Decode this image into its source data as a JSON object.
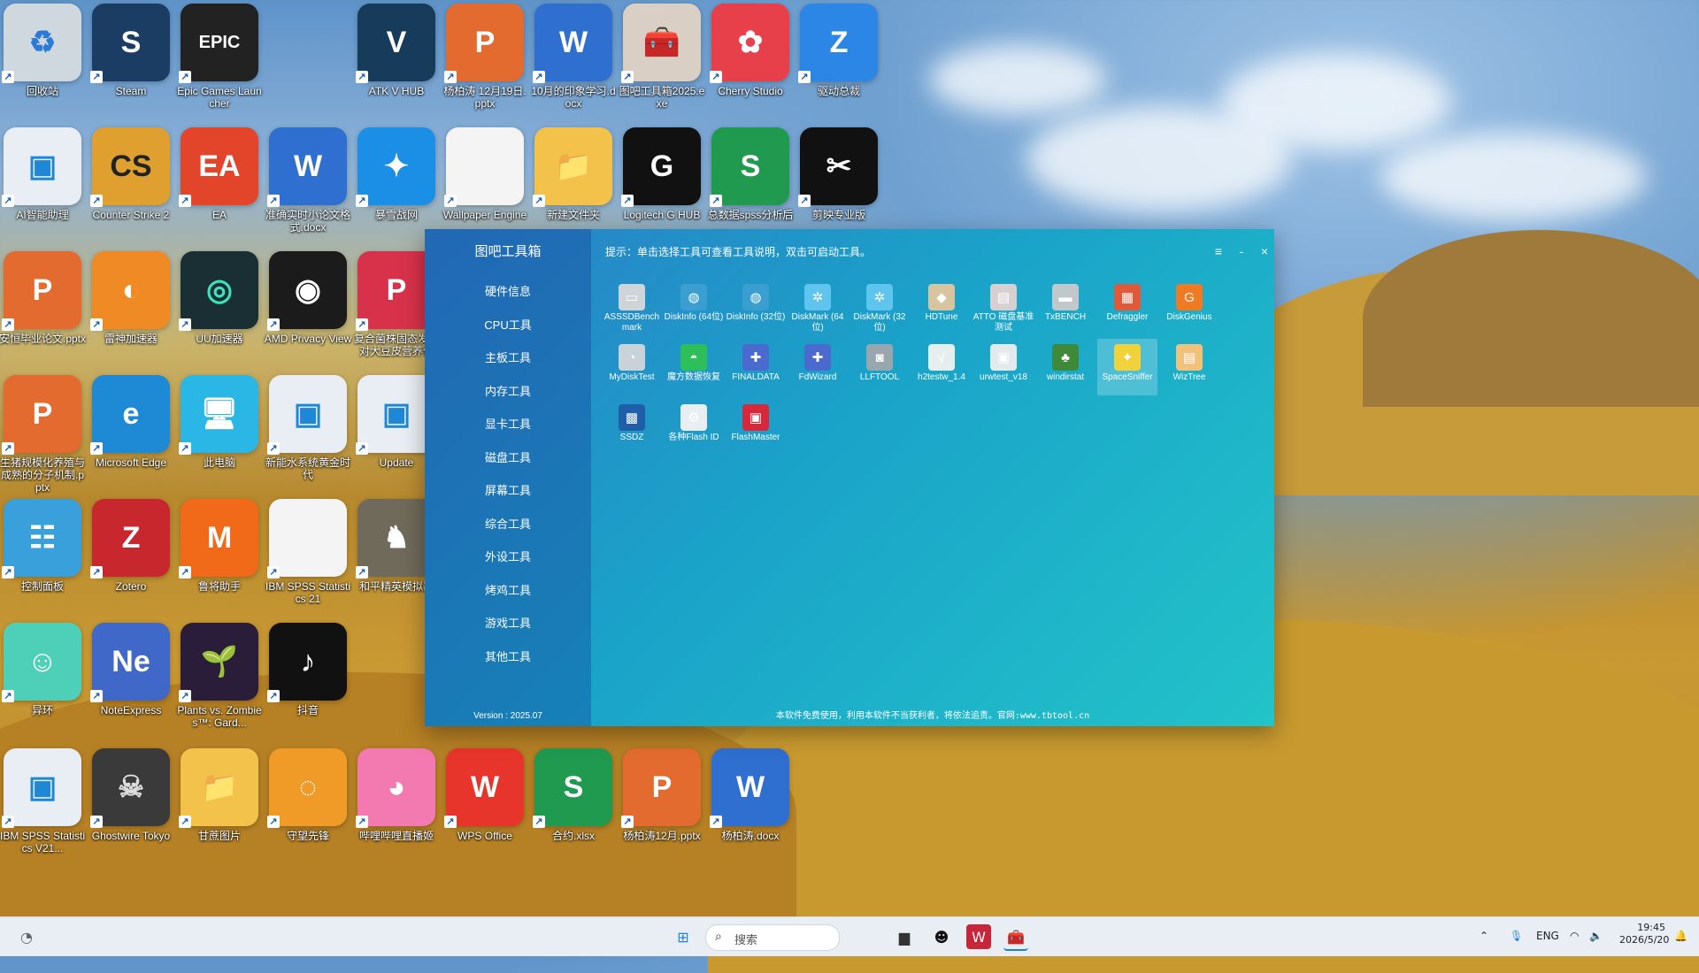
{
  "desktop": {
    "icons": [
      {
        "label": "回收站",
        "glyph": "♻",
        "color": "#cfd8df",
        "fg": "#2a7ad6"
      },
      {
        "label": "Steam",
        "glyph": "S",
        "color": "#1b3d63",
        "fg": "#fff"
      },
      {
        "label": "Epic Games Launcher",
        "glyph": "EPIC",
        "color": "#222",
        "fg": "#fff"
      },
      {
        "label": "ATK V HUB",
        "glyph": "V",
        "color": "#173b5a",
        "fg": "#fff"
      },
      {
        "label": "杨柏涛 12月19日.pptx",
        "glyph": "P",
        "color": "#e36b2f",
        "fg": "#fff"
      },
      {
        "label": "10月的印象学习.docx",
        "glyph": "W",
        "color": "#2f6fd0",
        "fg": "#fff"
      },
      {
        "label": "图吧工具箱2025.exe",
        "glyph": "🧰",
        "color": "#d9cfc4",
        "fg": "#333"
      },
      {
        "label": "Cherry Studio",
        "glyph": "✿",
        "color": "#e8404b",
        "fg": "#fff"
      },
      {
        "label": "驱动总裁",
        "glyph": "Z",
        "color": "#2b86e6",
        "fg": "#fff"
      },
      {
        "label": "AI智能助理",
        "glyph": "▣",
        "color": "#e8eef4",
        "fg": "#1e88d6"
      },
      {
        "label": "Counter Strike 2",
        "glyph": "CS",
        "color": "#e0a030",
        "fg": "#222"
      },
      {
        "label": "EA",
        "glyph": "EA",
        "color": "#e2452a",
        "fg": "#fff"
      },
      {
        "label": "准确实时小论文格式.docx",
        "glyph": "W",
        "color": "#2f6fd0",
        "fg": "#fff"
      },
      {
        "label": "暴雪战网",
        "glyph": "✦",
        "color": "#1b8fe6",
        "fg": "#fff"
      },
      {
        "label": "Wallpaper Engine",
        "glyph": "",
        "color": "#f4f4f4",
        "fg": "#333"
      },
      {
        "label": "新建文件夹",
        "glyph": "📁",
        "color": "#f2c24b",
        "fg": "#333"
      },
      {
        "label": "Logitech G HUB",
        "glyph": "G",
        "color": "#111",
        "fg": "#fff"
      },
      {
        "label": "总数据spss分析后",
        "glyph": "S",
        "color": "#1f9a4f",
        "fg": "#fff"
      },
      {
        "label": "剪映专业版",
        "glyph": "✂",
        "color": "#111",
        "fg": "#fff"
      },
      {
        "label": "安恒毕业论文.pptx",
        "glyph": "P",
        "color": "#e36b2f",
        "fg": "#fff"
      },
      {
        "label": "雷神加速器",
        "glyph": "◐",
        "color": "#f08a24",
        "fg": "#fff"
      },
      {
        "label": "UU加速器",
        "glyph": "◎",
        "color": "#1a2f33",
        "fg": "#3fe0c0"
      },
      {
        "label": "AMD Privacy View",
        "glyph": "◉",
        "color": "#1b1b1b",
        "fg": "#fff"
      },
      {
        "label": "复合菌株固态发酵对大豆皮营养价",
        "glyph": "P",
        "color": "#d8324a",
        "fg": "#fff"
      },
      {
        "label": "生猪规模化养殖与成熟的分子机制.pptx",
        "glyph": "P",
        "color": "#e36b2f",
        "fg": "#fff"
      },
      {
        "label": "Microsoft Edge",
        "glyph": "e",
        "color": "#1e8ad6",
        "fg": "#fff"
      },
      {
        "label": "此电脑",
        "glyph": "🖥",
        "color": "#2bb7e6",
        "fg": "#fff"
      },
      {
        "label": "新能水系统黄金时代",
        "glyph": "▣",
        "color": "#e8eef4",
        "fg": "#1e88d6"
      },
      {
        "label": "Update",
        "glyph": "▣",
        "color": "#e8eef4",
        "fg": "#1e88d6"
      },
      {
        "label": "控制面板",
        "glyph": "☷",
        "color": "#3aa0dc",
        "fg": "#fff"
      },
      {
        "label": "Zotero",
        "glyph": "Z",
        "color": "#c8272d",
        "fg": "#fff"
      },
      {
        "label": "鲁将助手",
        "glyph": "M",
        "color": "#f06a1a",
        "fg": "#fff"
      },
      {
        "label": "IBM SPSS Statistics 21",
        "glyph": "",
        "color": "#f4f4f4",
        "fg": "#333"
      },
      {
        "label": "和平精英模拟器",
        "glyph": "♞",
        "color": "#6f6a5a",
        "fg": "#fff"
      },
      {
        "label": "异环",
        "glyph": "☺",
        "color": "#4ecfb8",
        "fg": "#fff"
      },
      {
        "label": "NoteExpress",
        "glyph": "Ne",
        "color": "#3f68c8",
        "fg": "#fff"
      },
      {
        "label": "Plants vs. Zombies™: Gard...",
        "glyph": "🌱",
        "color": "#2a1d3a",
        "fg": "#fff"
      },
      {
        "label": "抖音",
        "glyph": "♪",
        "color": "#111",
        "fg": "#fff"
      },
      {
        "label": "IBM SPSS Statistics V21...",
        "glyph": "▣",
        "color": "#e8eef4",
        "fg": "#1e88d6"
      },
      {
        "label": "Ghostwire Tokyo",
        "glyph": "☠",
        "color": "#3a3a3a",
        "fg": "#ddd"
      },
      {
        "label": "甘蔗图片",
        "glyph": "📁",
        "color": "#f2c24b",
        "fg": "#333"
      },
      {
        "label": "守望先锋",
        "glyph": "◌",
        "color": "#f09a28",
        "fg": "#fff"
      },
      {
        "label": "哔哩哔哩直播姬",
        "glyph": "◕",
        "color": "#f37ab0",
        "fg": "#fff"
      },
      {
        "label": "WPS Office",
        "glyph": "W",
        "color": "#e8352b",
        "fg": "#fff"
      },
      {
        "label": "合约.xlsx",
        "glyph": "S",
        "color": "#1f9a4f",
        "fg": "#fff"
      },
      {
        "label": "杨柏涛12月.pptx",
        "glyph": "P",
        "color": "#e36b2f",
        "fg": "#fff"
      },
      {
        "label": "杨柏涛.docx",
        "glyph": "W",
        "color": "#2f6fd0",
        "fg": "#fff"
      }
    ]
  },
  "app": {
    "title": "图吧工具箱",
    "tip": "提示：单击选择工具可查看工具说明，双击可启动工具。",
    "window_buttons": {
      "menu": "≡",
      "minimize": "-",
      "close": "×"
    },
    "categories": [
      "硬件信息",
      "CPU工具",
      "主板工具",
      "内存工具",
      "显卡工具",
      "磁盘工具",
      "屏幕工具",
      "综合工具",
      "外设工具",
      "烤鸡工具",
      "游戏工具",
      "其他工具"
    ],
    "version": "Version : 2025.07",
    "footer": "本软件免费使用，利用本软件不当获利者，将依法追责。官网:www.tbtool.cn",
    "tools": [
      {
        "label": "ASSSDBench mark",
        "glyph": "▭",
        "bg": "#cfd4d8"
      },
      {
        "label": "DiskInfo (64位)",
        "glyph": "◍",
        "bg": "#3a9fd0"
      },
      {
        "label": "DiskInfo (32位)",
        "glyph": "◍",
        "bg": "#3a9fd0"
      },
      {
        "label": "DiskMark (64位)",
        "glyph": "✲",
        "bg": "#5fc4ee"
      },
      {
        "label": "DiskMark (32位)",
        "glyph": "✲",
        "bg": "#5fc4ee"
      },
      {
        "label": "HDTune",
        "glyph": "◆",
        "bg": "#d9c4a0"
      },
      {
        "label": "ATTO 磁盘基准测试",
        "glyph": "▤",
        "bg": "#d6d0d0"
      },
      {
        "label": "TxBENCH",
        "glyph": "▬",
        "bg": "#c0c8cc"
      },
      {
        "label": "Defraggler",
        "glyph": "▦",
        "bg": "#e05a3a"
      },
      {
        "label": "DiskGenius",
        "glyph": "G",
        "bg": "#f07a22"
      },
      {
        "label": "MyDiskTest",
        "glyph": "◔",
        "bg": "#c9d2d8"
      },
      {
        "label": "魔方数据恢复",
        "glyph": "◓",
        "bg": "#2fbf5a"
      },
      {
        "label": "FINALDATA",
        "glyph": "✚",
        "bg": "#4a6ad0"
      },
      {
        "label": "FdWizard",
        "glyph": "✚",
        "bg": "#4a6ad0"
      },
      {
        "label": "LLFTOOL",
        "glyph": "◙",
        "bg": "#9aa6ad"
      },
      {
        "label": "h2testw_1.4",
        "glyph": "√",
        "bg": "#e6eef0"
      },
      {
        "label": "urwtest_v18",
        "glyph": "▣",
        "bg": "#e2eaee"
      },
      {
        "label": "windirstat",
        "glyph": "♣",
        "bg": "#3f8a3a"
      },
      {
        "label": "SpaceSniffer",
        "glyph": "✦",
        "bg": "#f2d23a"
      },
      {
        "label": "WizTree",
        "glyph": "▤",
        "bg": "#f2c27a"
      },
      {
        "label": "SSDZ",
        "glyph": "▩",
        "bg": "#1f5faa"
      },
      {
        "label": "各种Flash ID",
        "glyph": "⚙",
        "bg": "#e8eef2"
      },
      {
        "label": "FlashMaster",
        "glyph": "▣",
        "bg": "#d8263a"
      }
    ],
    "selected_tool": "SpaceSniffer"
  },
  "taskbar": {
    "search_placeholder": "搜索",
    "lang": "ENG",
    "time": "19:45",
    "date": "2026/5/20"
  },
  "colors": {
    "accent": "#1aa3c9",
    "sidebar": "#2a5fb8"
  }
}
